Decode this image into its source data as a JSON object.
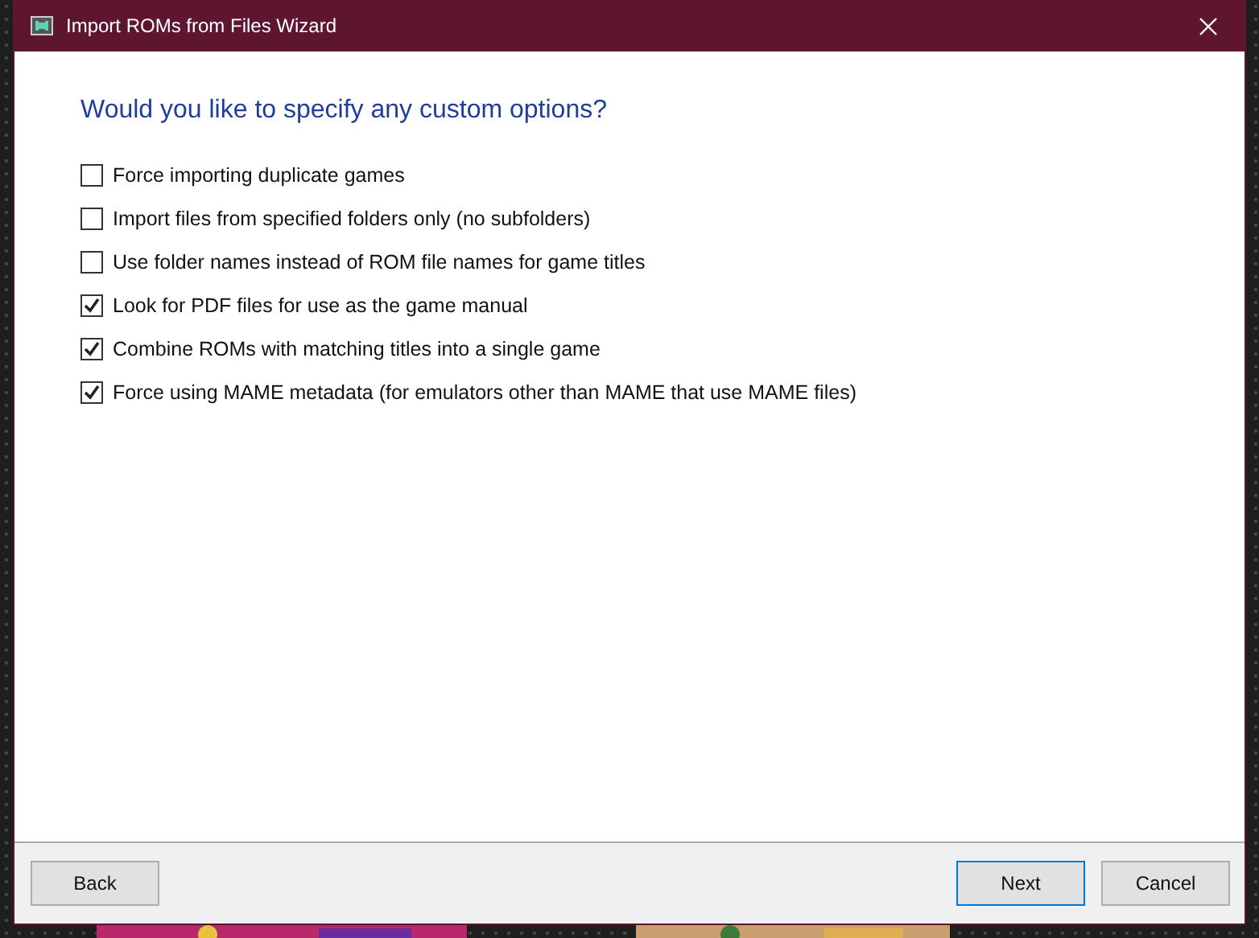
{
  "window": {
    "title": "Import ROMs from Files Wizard"
  },
  "heading": "Would you like to specify any custom options?",
  "options": [
    {
      "label": "Force importing duplicate games",
      "checked": false
    },
    {
      "label": "Import files from specified folders only (no subfolders)",
      "checked": false
    },
    {
      "label": "Use folder names instead of ROM file names for game titles",
      "checked": false
    },
    {
      "label": "Look for PDF files for use as the game manual",
      "checked": true
    },
    {
      "label": "Combine ROMs with matching titles into a single game",
      "checked": true
    },
    {
      "label": "Force using MAME metadata (for emulators other than MAME that use MAME files)",
      "checked": true
    }
  ],
  "buttons": [
    {
      "label": "Back",
      "kind": "back",
      "focused": false
    },
    {
      "label": "Next",
      "kind": "next",
      "focused": true
    },
    {
      "label": "Cancel",
      "kind": "cancel",
      "focused": false
    }
  ]
}
